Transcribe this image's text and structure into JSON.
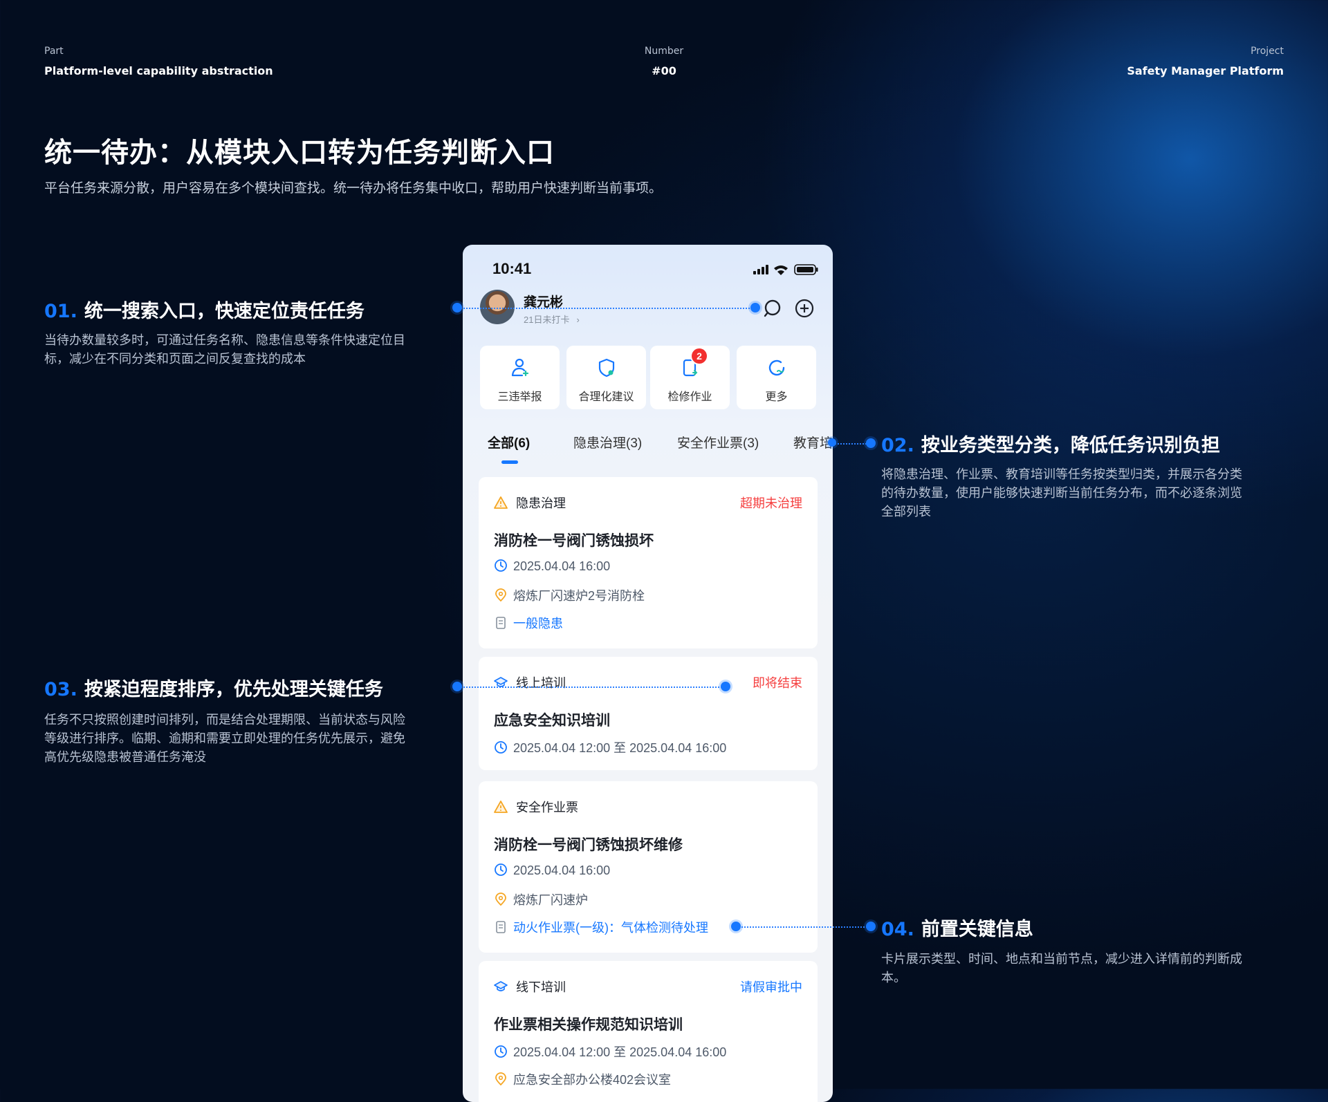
{
  "header": {
    "part_label": "Part",
    "part_value": "Platform-level capability abstraction",
    "number_label": "Number",
    "number_value": "#00",
    "project_label": "Project",
    "project_value": "Safety Manager Platform"
  },
  "page": {
    "title": "统一待办：从模块入口转为任务判断入口",
    "subtitle": "平台任务来源分散，用户容易在多个模块间查找。统一待办将任务集中收口，帮助用户快速判断当前事项。"
  },
  "annotations": [
    {
      "num": "01.",
      "title": "统一搜索入口，快速定位责任任务",
      "desc_lines": [
        "当待办数量较多时，可通过任务名称、隐患信息等条件快速定位目",
        "标，减少在不同分类和页面之间反复查找的成本"
      ]
    },
    {
      "num": "02.",
      "title": "按业务类型分类，降低任务识别负担",
      "desc_lines": [
        "将隐患治理、作业票、教育培训等任务按类型归类，并展示各分类",
        "的待办数量，使用户能够快速判断当前任务分布，而不必逐条浏览",
        "全部列表"
      ]
    },
    {
      "num": "03.",
      "title": "按紧迫程度排序，优先处理关键任务",
      "desc_lines": [
        "任务不只按照创建时间排列，而是结合处理期限、当前状态与风险",
        "等级进行排序。临期、逾期和需要立即处理的任务优先展示，避免",
        "高优先级隐患被普通任务淹没"
      ]
    },
    {
      "num": "04.",
      "title": "前置关键信息",
      "desc_lines": [
        "卡片展示类型、时间、地点和当前节点，减少进入详情前的判断成",
        "本。"
      ]
    }
  ],
  "phone": {
    "status_time": "10:41",
    "user_name": "龚元彬",
    "user_sub": "21日未打卡",
    "quick_actions": [
      {
        "label": "三违举报",
        "icon": "person-report-icon"
      },
      {
        "label": "合理化建议",
        "icon": "shield-suggestion-icon"
      },
      {
        "label": "检修作业",
        "icon": "document-repair-icon",
        "badge": "2"
      },
      {
        "label": "更多",
        "icon": "more-circle-icon"
      }
    ],
    "tabs": [
      "全部(6)",
      "隐患治理(3)",
      "安全作业票(3)",
      "教育培"
    ],
    "cards": [
      {
        "type": "隐患治理",
        "status": "超期未治理",
        "title": "消防栓一号阀门锈蚀损坏",
        "time": "2025.04.04 16:00",
        "location": "熔炼厂闪速炉2号消防栓",
        "node": "一般隐患"
      },
      {
        "type": "线上培训",
        "status": "即将结束",
        "title": "应急安全知识培训",
        "time": "2025.04.04 12:00  至  2025.04.04 16:00"
      },
      {
        "type": "安全作业票",
        "status": "",
        "title": "消防栓一号阀门锈蚀损坏维修",
        "time": "2025.04.04 16:00",
        "location": "熔炼厂闪速炉",
        "node": "动火作业票(一级)：气体检测待处理"
      },
      {
        "type": "线下培训",
        "status": "请假审批中",
        "title": "作业票相关操作规范知识培训",
        "time": "2025.04.04 12:00  至  2025.04.04 16:00",
        "location": "应急安全部办公楼402会议室"
      }
    ]
  },
  "colors": {
    "accent": "#1677ff",
    "danger": "#f53f3f",
    "background": "#030d1f"
  }
}
